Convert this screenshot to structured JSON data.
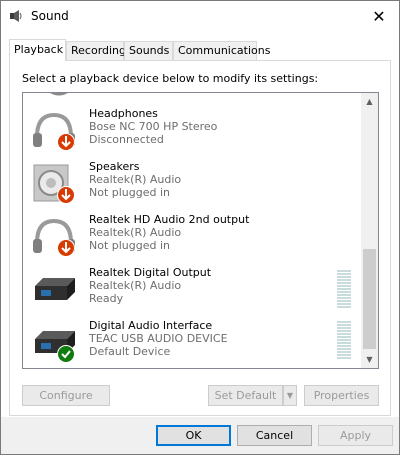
{
  "window": {
    "title": "Sound"
  },
  "tabs": [
    {
      "label": "Playback"
    },
    {
      "label": "Recording"
    },
    {
      "label": "Sounds"
    },
    {
      "label": "Communications"
    }
  ],
  "instruction": "Select a playback device below to modify its settings:",
  "devices": [
    {
      "name": "Headphones",
      "driver": "Bose NC 700 HP Stereo",
      "status": "Disconnected",
      "icon": "headphones-icon",
      "badge": "disconnected-arrow-icon"
    },
    {
      "name": "Speakers",
      "driver": "Realtek(R) Audio",
      "status": "Not plugged in",
      "icon": "speaker-icon",
      "badge": "unplugged-arrow-icon"
    },
    {
      "name": "Realtek HD Audio 2nd output",
      "driver": "Realtek(R) Audio",
      "status": "Not plugged in",
      "icon": "headphones-icon",
      "badge": "unplugged-arrow-icon"
    },
    {
      "name": "Realtek Digital Output",
      "driver": "Realtek(R) Audio",
      "status": "Ready",
      "icon": "digital-output-icon",
      "badge": ""
    },
    {
      "name": "Digital Audio Interface",
      "driver": "TEAC USB AUDIO DEVICE",
      "status": "Default Device",
      "icon": "digital-output-icon",
      "badge": "default-check-icon"
    }
  ],
  "buttons": {
    "configure": "Configure",
    "set_default": "Set Default",
    "properties": "Properties",
    "ok": "OK",
    "cancel": "Cancel",
    "apply": "Apply"
  },
  "colors": {
    "accent": "#0078d7",
    "badge_red": "#d83b01",
    "badge_green": "#107c10"
  }
}
